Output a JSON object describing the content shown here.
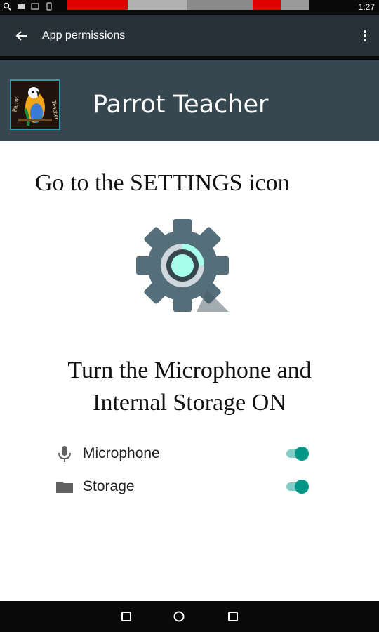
{
  "status_bar": {
    "time": "1:27",
    "icons": [
      "search-icon",
      "notification-icon",
      "image-icon",
      "phone-icon",
      "bluetooth-icon",
      "wifi-icon",
      "signal-icon",
      "battery-icon"
    ],
    "accent_colors": {
      "bar": "#0a0a0a",
      "red": "#e00000",
      "gray": "#b0b0b0"
    }
  },
  "app_bar": {
    "title": "App permissions",
    "background": "#263238"
  },
  "banner": {
    "app_name": "Parrot Teacher",
    "background": "#37474f",
    "logo_accent": "#2a9ca8"
  },
  "content": {
    "instruction_1": "Go to the SETTINGS icon",
    "instruction_2_line_1": "Turn the Microphone and",
    "instruction_2_line_2": "Internal Storage ON"
  },
  "permissions": [
    {
      "icon": "microphone-icon",
      "label": "Microphone",
      "enabled": true
    },
    {
      "icon": "folder-icon",
      "label": "Storage",
      "enabled": true
    }
  ],
  "colors": {
    "toggle_thumb": "#009688",
    "toggle_track": "#80cbc4",
    "gear_body": "#546e7a",
    "gear_center": "#a7ffeb"
  },
  "nav_bar": {
    "buttons": [
      "recents-square-icon",
      "home-circle-icon",
      "back-square-icon"
    ]
  }
}
